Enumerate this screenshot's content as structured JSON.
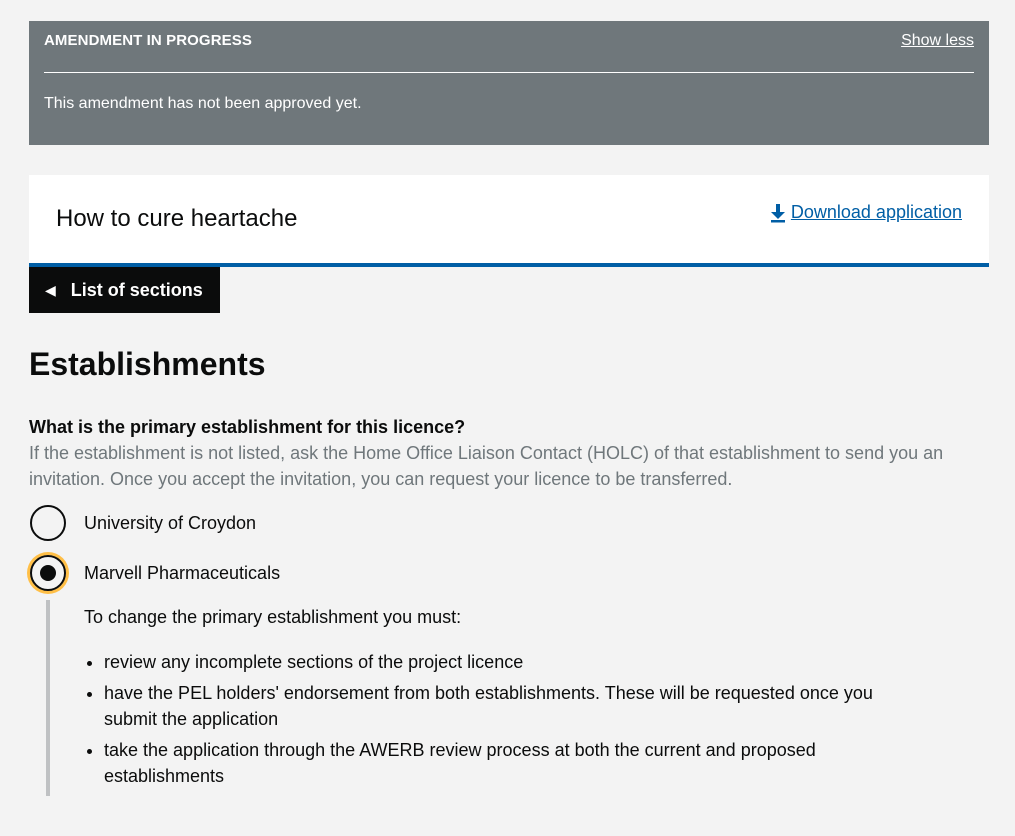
{
  "banner": {
    "title": "AMENDMENT IN PROGRESS",
    "toggle_label": "Show less",
    "message": "This amendment has not been approved yet."
  },
  "project": {
    "title": "How to cure heartache",
    "download_label": "Download application",
    "download_icon": "download-icon"
  },
  "nav": {
    "sections_button_label": "List of sections",
    "sections_button_icon": "triangle-left-icon"
  },
  "page": {
    "heading": "Establishments"
  },
  "question": {
    "label": "What is the primary establishment for this licence?",
    "hint": "If the establishment is not listed, ask the Home Office Liaison Contact (HOLC) of that establishment to send you an invitation. Once you accept the invitation, you can request your licence to be transferred."
  },
  "options": [
    {
      "label": "University of Croydon",
      "selected": false
    },
    {
      "label": "Marvell Pharmaceuticals",
      "selected": true
    }
  ],
  "conditional": {
    "intro": "To change the primary establishment you must:",
    "items": [
      "review any incomplete sections of the project licence",
      "have the PEL holders' endorsement from both establishments. These will be requested once you submit the application",
      "take the application through the AWERB review process at both the current and proposed establishments"
    ]
  },
  "colors": {
    "banner_bg": "#6f777b",
    "link": "#005ea5",
    "focus": "#ffbf47",
    "text": "#0b0c0c",
    "hint": "#6f777b",
    "background": "#f3f3f3"
  }
}
